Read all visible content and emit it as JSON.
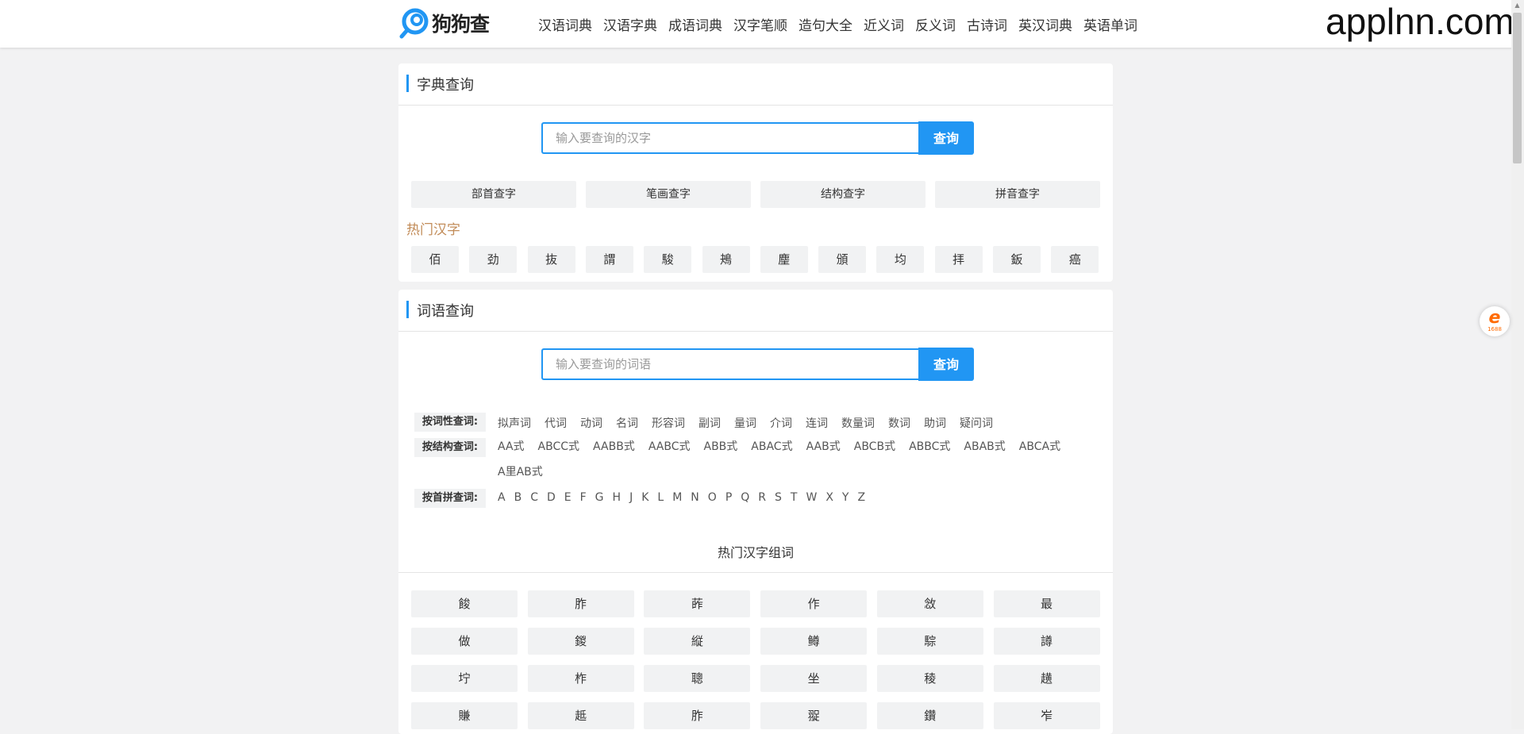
{
  "logo": {
    "text": "狗狗查"
  },
  "nav": [
    "汉语词典",
    "汉语字典",
    "成语词典",
    "汉字笔顺",
    "造句大全",
    "近义词",
    "反义词",
    "古诗词",
    "英汉词典",
    "英语单词"
  ],
  "watermark": "applnn.com",
  "ali_badge": {
    "label": "1688",
    "icon": "alibaba-1688-icon"
  },
  "zidian": {
    "title": "字典查询",
    "placeholder": "输入要查询的汉字",
    "search_btn": "查询",
    "methods": [
      "部首查字",
      "笔画查字",
      "结构查字",
      "拼音查字"
    ],
    "hot_label": "热门汉字",
    "hot_chars": [
      "佰",
      "劲",
      "抜",
      "謂",
      "駿",
      "鴂",
      "麈",
      "頒",
      "均",
      "拝",
      "鈑",
      "癌"
    ]
  },
  "ciyu": {
    "title": "词语查询",
    "placeholder": "输入要查询的词语",
    "search_btn": "查询",
    "rows": [
      {
        "label": "按词性查词:",
        "items": [
          "拟声词",
          "代词",
          "动词",
          "名词",
          "形容词",
          "副词",
          "量词",
          "介词",
          "连词",
          "数量词",
          "数词",
          "助词",
          "疑问词"
        ]
      },
      {
        "label": "按结构查词:",
        "items": [
          "AA式",
          "ABCC式",
          "AABB式",
          "AABC式",
          "ABB式",
          "ABAC式",
          "AAB式",
          "ABCB式",
          "ABBC式",
          "ABAB式",
          "ABCA式",
          "A里AB式"
        ]
      },
      {
        "label": "按首拼查词:",
        "items": [
          "A",
          "B",
          "C",
          "D",
          "E",
          "F",
          "G",
          "H",
          "J",
          "K",
          "L",
          "M",
          "N",
          "O",
          "P",
          "Q",
          "R",
          "S",
          "T",
          "W",
          "X",
          "Y",
          "Z"
        ]
      }
    ],
    "hot_zuci_title": "热门汉字组词",
    "hot_zuci": [
      "餕",
      "胙",
      "葃",
      "作",
      "敜",
      "最",
      "做",
      "鍐",
      "縦",
      "鳟",
      "騌",
      "譐",
      "坾",
      "柞",
      "聰",
      "坐",
      "稜",
      "趪",
      "賺",
      "趆",
      "胙",
      "䎌",
      "鑽",
      "岝"
    ]
  }
}
